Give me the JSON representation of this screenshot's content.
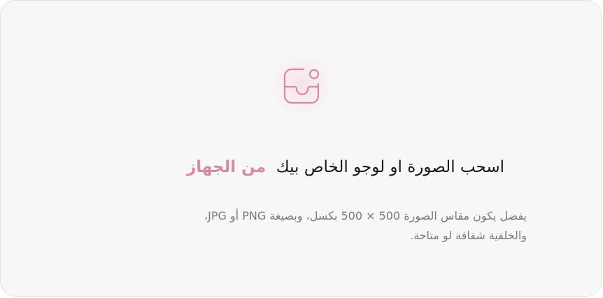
{
  "dropzone": {
    "title_prefix": "اسحب الصورة او لوجو الخاص بيك",
    "title_link": "من الجهاز",
    "hint_line1": "يفضل يكون مقاس الصورة 500 × 500 بكسل، وبصيغة PNG أو JPG،",
    "hint_line2": "والخلفية شفافة لو متاحة.",
    "icon": "image-upload-icon"
  },
  "colors": {
    "accent": "#d48a9f",
    "background": "#f8f7f8",
    "text": "#161616",
    "muted": "#7a7a7a"
  }
}
